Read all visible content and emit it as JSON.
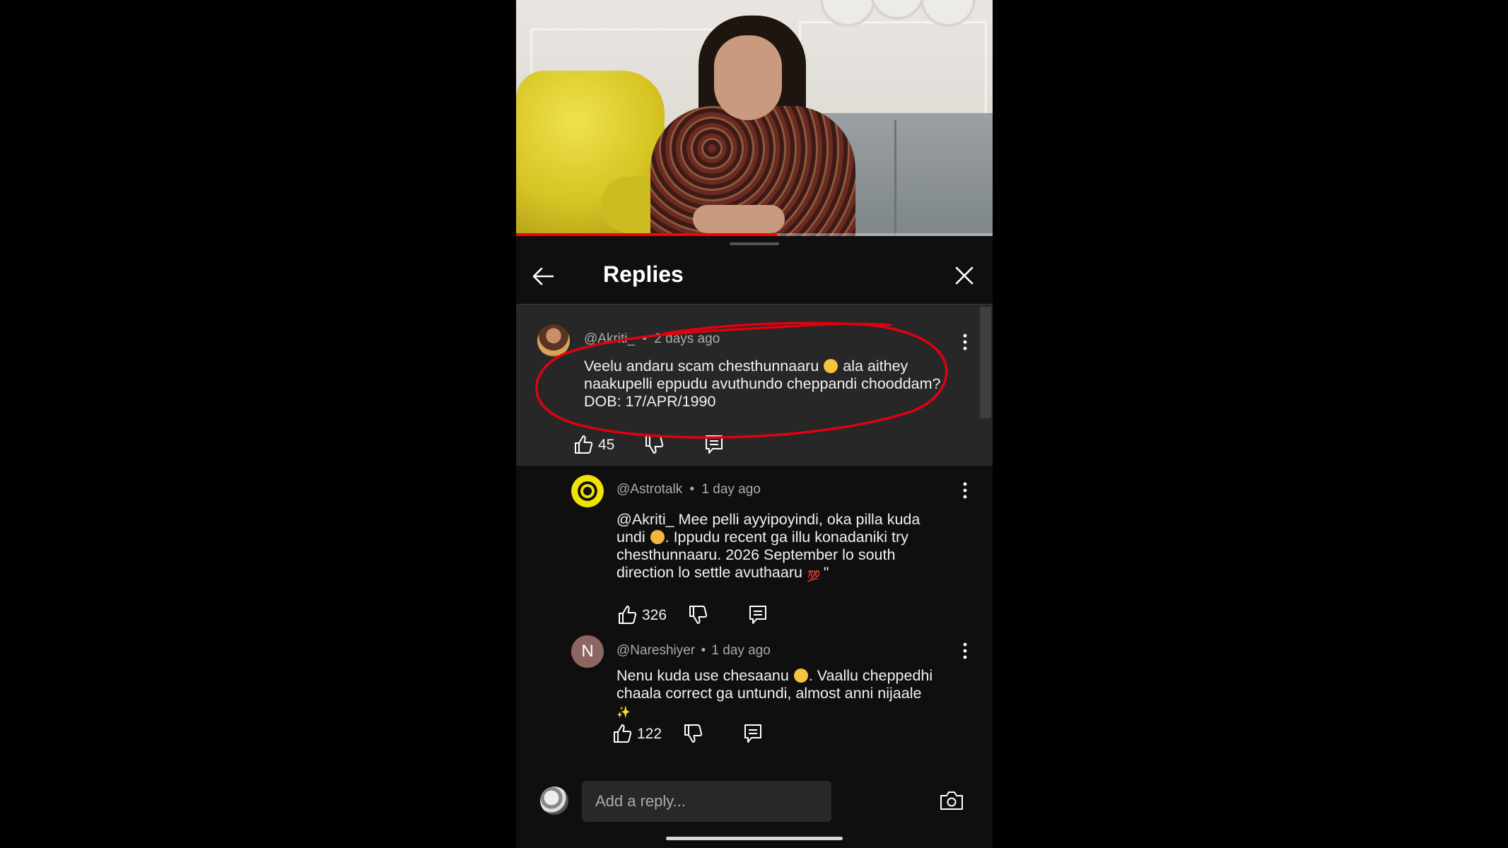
{
  "player": {
    "progress_fraction": 0.547
  },
  "header": {
    "title": "Replies"
  },
  "comments": [
    {
      "handle": "@Akriti_",
      "separator": "•",
      "time": "2 days ago",
      "lines": [
        "Veelu andaru scam chesthunnaaru",
        "ala aithey",
        "naakupelli eppudu avuthundo cheppandi chooddam?",
        "DOB: 17/APR/1990"
      ],
      "likes": "45"
    },
    {
      "handle": "@Astrotalk",
      "separator": "•",
      "time": "1 day ago",
      "lines": [
        "@Akriti_ Mee pelli ayyipoyindi, oka pilla kuda",
        "undi",
        ". Ippudu recent ga illu konadaniki try",
        "chesthunnaaru. 2026 September lo south",
        "direction lo settle avuthaaru",
        "\""
      ],
      "likes": "326"
    },
    {
      "handle": "@Nareshiyer",
      "separator": "•",
      "time": "1 day ago",
      "avatar_letter": "N",
      "lines": [
        "Nenu kuda use chesaanu",
        ". Vaallu cheppedhi",
        "chaala correct ga untundi, almost anni nijaale"
      ],
      "likes": "122"
    }
  ],
  "reply_bar": {
    "placeholder": "Add a reply..."
  },
  "colors": {
    "accent": "#ff0000",
    "annotation": "#e3000f",
    "panel": "#0f0f0f",
    "highlight_row": "#272727"
  },
  "icons": [
    "back-arrow-icon",
    "close-icon",
    "more-vert-icon",
    "thumb-up-icon",
    "thumb-down-icon",
    "reply-icon",
    "camera-icon"
  ]
}
